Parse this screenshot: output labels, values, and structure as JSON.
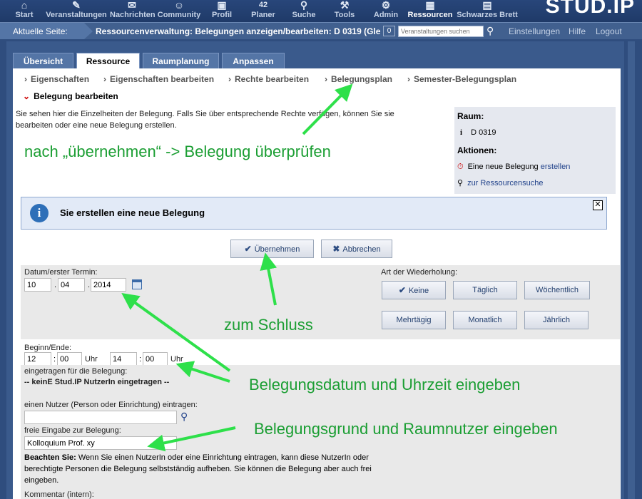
{
  "nav": {
    "items": [
      {
        "label": "Start",
        "icon": "home-icon"
      },
      {
        "label": "Veranstaltungen",
        "icon": "courses-icon"
      },
      {
        "label": "Nachrichten",
        "icon": "mail-icon"
      },
      {
        "label": "Community",
        "icon": "community-icon"
      },
      {
        "label": "Profil",
        "icon": "profile-icon"
      },
      {
        "label": "Planer",
        "icon": "calendar-icon",
        "badge": "42"
      },
      {
        "label": "Suche",
        "icon": "search-icon"
      },
      {
        "label": "Tools",
        "icon": "tools-icon"
      },
      {
        "label": "Admin",
        "icon": "admin-icon"
      },
      {
        "label": "Ressourcen",
        "icon": "resources-icon"
      },
      {
        "label": "Schwarzes Brett",
        "icon": "board-icon"
      }
    ],
    "logo": "STUD.IP"
  },
  "crumb": {
    "label": "Aktuelle Seite:",
    "title": "Ressourcenverwaltung: Belegungen anzeigen/bearbeiten: D 0319 (Gle",
    "count": "0",
    "search_placeholder": "Veranstaltungen suchen",
    "links": [
      "Einstellungen",
      "Hilfe",
      "Logout"
    ]
  },
  "tabs": [
    "Übersicht",
    "Ressource",
    "Raumplanung",
    "Anpassen"
  ],
  "subnav": [
    "Eigenschaften",
    "Eigenschaften bearbeiten",
    "Rechte bearbeiten",
    "Belegungsplan",
    "Semester-Belegungsplan"
  ],
  "active_sub": "Belegung bearbeiten",
  "intro": "Sie sehen hier die Einzelheiten der Belegung. Falls Sie über entsprechende Rechte verfügen, können Sie sie bearbeiten oder eine neue Belegung erstellen.",
  "sidebox": {
    "room_heading": "Raum:",
    "room": "D 0319",
    "actions_heading": "Aktionen:",
    "new_text": "Eine neue Belegung",
    "new_link": "erstellen",
    "search_link": "zur Ressourcensuche"
  },
  "info": "Sie erstellen eine neue Belegung",
  "buttons": {
    "accept": "Übernehmen",
    "cancel": "Abbrechen"
  },
  "form": {
    "date_label": "Datum/erster Termin:",
    "day": "10",
    "month": "04",
    "year": "2014",
    "repeat_label": "Art der Wiederholung:",
    "repeat": [
      "Keine",
      "Täglich",
      "Wöchentlich",
      "Mehrtägig",
      "Monatlich",
      "Jährlich"
    ],
    "time_label": "Beginn/Ende:",
    "start_h": "12",
    "start_m": "00",
    "end_h": "14",
    "end_m": "00",
    "unit": "Uhr",
    "registered_label": "eingetragen für die Belegung:",
    "registered_value": "-- keinE Stud.IP NutzerIn eingetragen --",
    "user_label": "einen Nutzer (Person oder Einrichtung) eintragen:",
    "free_label": "freie Eingabe zur Belegung:",
    "free_value": "Kolloquium Prof. xy",
    "note_bold": "Beachten Sie:",
    "note": "Wenn Sie einen NutzerIn oder eine Einrichtung eintragen, kann diese NutzerIn oder berechtigte Personen die Belegung selbstständig aufheben. Sie können die Belegung aber auch frei eingeben.",
    "comment_label": "Kommentar (intern):"
  },
  "annotations": {
    "a1": "nach „übernehmen“ -> Belegung überprüfen",
    "a2": "zum Schluss",
    "a3": "Belegungsdatum und Uhrzeit eingeben",
    "a4": "Belegungsgrund und Raumnutzer eingeben"
  },
  "colors": {
    "annotation": "#1b9e33",
    "nav": "#28467a",
    "accent": "#22438b"
  }
}
